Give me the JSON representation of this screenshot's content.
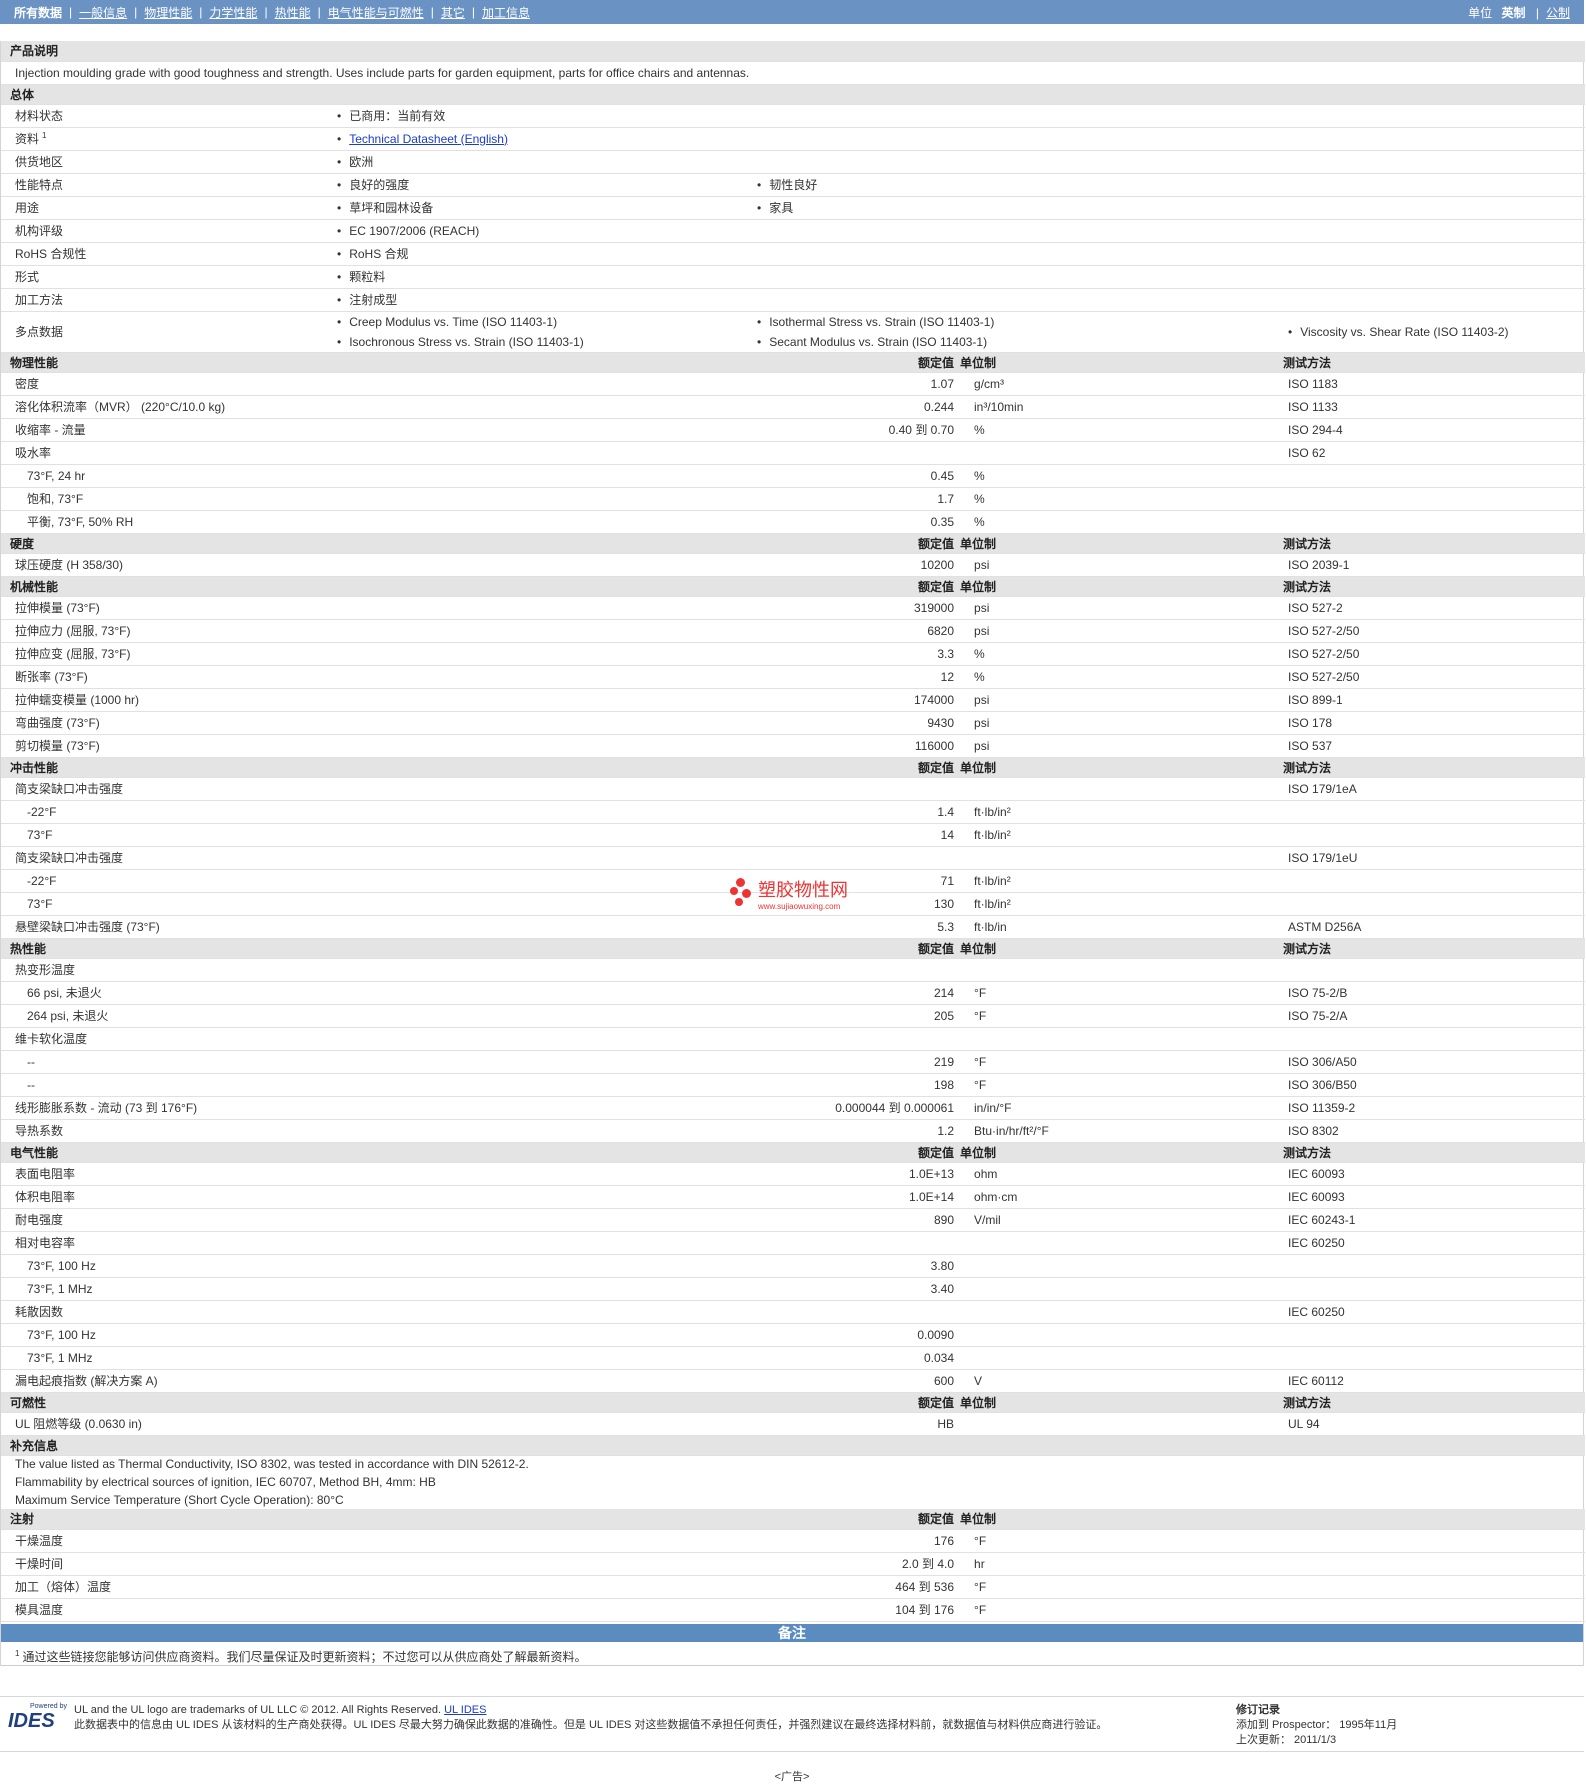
{
  "nav": {
    "tabs": [
      "所有数据",
      "一般信息",
      "物理性能",
      "力学性能",
      "热性能",
      "电气性能与可燃性",
      "其它",
      "加工信息"
    ],
    "units_label": "单位",
    "unit_active": "英制",
    "unit_other": "公制"
  },
  "headers": {
    "nominal": "额定值",
    "unit": "单位制",
    "method": "测试方法"
  },
  "description": {
    "title": "产品说明",
    "text": "Injection moulding grade with good toughness and strength. Uses include parts for garden equipment, parts for office chairs and antennas."
  },
  "general": {
    "title": "总体",
    "rows": [
      {
        "label": "材料状态",
        "col1": "已商用：当前有效"
      },
      {
        "label": "资料",
        "sup": "1",
        "link": "Technical Datasheet (English)"
      },
      {
        "label": "供货地区",
        "col1": "欧洲"
      },
      {
        "label": "性能特点",
        "col1": "良好的强度",
        "col2": "韧性良好"
      },
      {
        "label": "用途",
        "col1": "草坪和园林设备",
        "col2": "家具"
      },
      {
        "label": "机构评级",
        "col1": "EC 1907/2006 (REACH)"
      },
      {
        "label": "RoHS 合规性",
        "col1": "RoHS 合规"
      },
      {
        "label": "形式",
        "col1": "颗粒料"
      },
      {
        "label": "加工方法",
        "col1": "注射成型"
      }
    ],
    "multipoint": {
      "label": "多点数据",
      "col1": [
        "Creep Modulus vs. Time (ISO 11403-1)",
        "Isochronous Stress vs. Strain (ISO 11403-1)"
      ],
      "col2": [
        "Isothermal Stress vs. Strain (ISO 11403-1)",
        "Secant Modulus vs. Strain (ISO 11403-1)"
      ],
      "col3": [
        "Viscosity vs. Shear Rate (ISO 11403-2)"
      ]
    }
  },
  "physical": {
    "title": "物理性能",
    "rows": [
      {
        "label": "密度",
        "value": "1.07",
        "unit": "g/cm³",
        "method": "ISO 1183"
      },
      {
        "label": "溶化体积流率（MVR） (220°C/10.0 kg)",
        "value": "0.244",
        "unit": "in³/10min",
        "method": "ISO 1133"
      },
      {
        "label": "收缩率 - 流量",
        "value": "0.40 到 0.70",
        "unit": "%",
        "method": "ISO 294-4"
      },
      {
        "label": "吸水率",
        "value": "",
        "unit": "",
        "method": "ISO 62"
      },
      {
        "label": "73°F, 24 hr",
        "sub": true,
        "value": "0.45",
        "unit": "%",
        "method": ""
      },
      {
        "label": "饱和, 73°F",
        "sub": true,
        "value": "1.7",
        "unit": "%",
        "method": ""
      },
      {
        "label": "平衡, 73°F, 50% RH",
        "sub": true,
        "value": "0.35",
        "unit": "%",
        "method": ""
      }
    ]
  },
  "hardness": {
    "title": "硬度",
    "rows": [
      {
        "label": "球压硬度 (H 358/30)",
        "value": "10200",
        "unit": "psi",
        "method": "ISO 2039-1"
      }
    ]
  },
  "mechanical": {
    "title": "机械性能",
    "rows": [
      {
        "label": "拉伸模量 (73°F)",
        "value": "319000",
        "unit": "psi",
        "method": "ISO 527-2"
      },
      {
        "label": "拉伸应力 (屈服, 73°F)",
        "value": "6820",
        "unit": "psi",
        "method": "ISO 527-2/50"
      },
      {
        "label": "拉伸应变 (屈服, 73°F)",
        "value": "3.3",
        "unit": "%",
        "method": "ISO 527-2/50"
      },
      {
        "label": "断张率 (73°F)",
        "value": "12",
        "unit": "%",
        "method": "ISO 527-2/50"
      },
      {
        "label": "拉伸蠕变模量 (1000 hr)",
        "value": "174000",
        "unit": "psi",
        "method": "ISO 899-1"
      },
      {
        "label": "弯曲强度 (73°F)",
        "value": "9430",
        "unit": "psi",
        "method": "ISO 178"
      },
      {
        "label": "剪切模量 (73°F)",
        "value": "116000",
        "unit": "psi",
        "method": "ISO 537"
      }
    ]
  },
  "impact": {
    "title": "冲击性能",
    "rows": [
      {
        "label": "简支梁缺口冲击强度",
        "value": "",
        "unit": "",
        "method": "ISO 179/1eA"
      },
      {
        "label": "-22°F",
        "sub": true,
        "value": "1.4",
        "unit": "ft·lb/in²",
        "method": ""
      },
      {
        "label": "73°F",
        "sub": true,
        "value": "14",
        "unit": "ft·lb/in²",
        "method": ""
      },
      {
        "label": "简支梁缺口冲击强度",
        "value": "",
        "unit": "",
        "method": "ISO 179/1eU"
      },
      {
        "label": "-22°F",
        "sub": true,
        "value": "71",
        "unit": "ft·lb/in²",
        "method": ""
      },
      {
        "label": "73°F",
        "sub": true,
        "value": "130",
        "unit": "ft·lb/in²",
        "method": ""
      },
      {
        "label": "悬壁梁缺口冲击强度 (73°F)",
        "value": "5.3",
        "unit": "ft·lb/in",
        "method": "ASTM D256A"
      }
    ]
  },
  "thermal": {
    "title": "热性能",
    "rows": [
      {
        "label": "热变形温度",
        "value": "",
        "unit": "",
        "method": ""
      },
      {
        "label": "66 psi, 未退火",
        "sub": true,
        "value": "214",
        "unit": "°F",
        "method": "ISO 75-2/B"
      },
      {
        "label": "264 psi, 未退火",
        "sub": true,
        "value": "205",
        "unit": "°F",
        "method": "ISO 75-2/A"
      },
      {
        "label": "维卡软化温度",
        "value": "",
        "unit": "",
        "method": ""
      },
      {
        "label": "--",
        "sub": true,
        "value": "219",
        "unit": "°F",
        "method": "ISO 306/A50"
      },
      {
        "label": "--",
        "sub": true,
        "value": "198",
        "unit": "°F",
        "method": "ISO 306/B50"
      },
      {
        "label": "线形膨胀系数 - 流动 (73 到 176°F)",
        "value": "0.000044 到 0.000061",
        "unit": "in/in/°F",
        "method": "ISO 11359-2"
      },
      {
        "label": "导热系数",
        "value": "1.2",
        "unit": "Btu·in/hr/ft²/°F",
        "method": "ISO 8302"
      }
    ]
  },
  "electrical": {
    "title": "电气性能",
    "rows": [
      {
        "label": "表面电阻率",
        "value": "1.0E+13",
        "unit": "ohm",
        "method": "IEC 60093"
      },
      {
        "label": "体积电阻率",
        "value": "1.0E+14",
        "unit": "ohm·cm",
        "method": "IEC 60093"
      },
      {
        "label": "耐电强度",
        "value": "890",
        "unit": "V/mil",
        "method": "IEC 60243-1"
      },
      {
        "label": "相对电容率",
        "value": "",
        "unit": "",
        "method": "IEC 60250"
      },
      {
        "label": "73°F, 100 Hz",
        "sub": true,
        "value": "3.80",
        "unit": "",
        "method": ""
      },
      {
        "label": "73°F, 1 MHz",
        "sub": true,
        "value": "3.40",
        "unit": "",
        "method": ""
      },
      {
        "label": "耗散因数",
        "value": "",
        "unit": "",
        "method": "IEC 60250"
      },
      {
        "label": "73°F, 100 Hz",
        "sub": true,
        "value": "0.0090",
        "unit": "",
        "method": ""
      },
      {
        "label": "73°F, 1 MHz",
        "sub": true,
        "value": "0.034",
        "unit": "",
        "method": ""
      },
      {
        "label": "漏电起痕指数 (解决方案 A)",
        "value": "600",
        "unit": "V",
        "method": "IEC 60112"
      }
    ]
  },
  "flammability": {
    "title": "可燃性",
    "rows": [
      {
        "label": "UL 阻燃等级 (0.0630 in)",
        "value": "HB",
        "unit": "",
        "method": "UL 94"
      }
    ]
  },
  "supplemental": {
    "title": "补充信息",
    "lines": [
      "The value listed as Thermal Conductivity, ISO 8302, was tested in accordance with DIN 52612-2.",
      "Flammability by electrical sources of ignition, IEC 60707, Method BH, 4mm: HB",
      "Maximum Service Temperature (Short Cycle Operation): 80°C"
    ]
  },
  "injection": {
    "title": "注射",
    "rows": [
      {
        "label": "干燥温度",
        "value": "176",
        "unit": "°F"
      },
      {
        "label": "干燥时间",
        "value": "2.0 到 4.0",
        "unit": "hr"
      },
      {
        "label": "加工（熔体）温度",
        "value": "464 到 536",
        "unit": "°F"
      },
      {
        "label": "模具温度",
        "value": "104 到 176",
        "unit": "°F"
      }
    ]
  },
  "notes": {
    "title": "备注",
    "sup": "1",
    "text": "通过这些链接您能够访问供应商资料。我们尽量保证及时更新资料；不过您可以从供应商处了解最新资料。"
  },
  "footer": {
    "powered_by": "Powered by",
    "logo": "IDES",
    "line1": "UL and the UL logo are trademarks of UL LLC © 2012. All Rights Reserved.",
    "line1_link": "UL IDES",
    "line2": "此数据表中的信息由 UL IDES 从该材料的生产商处获得。UL IDES 尽最大努力确保此数据的准确性。但是 UL IDES 对这些数据值不承担任何责任，并强烈建议在最终选择材料前，就数据值与材料供应商进行验证。",
    "record_title": "修订记录",
    "added": "添加到 Prospector：  1995年11月",
    "updated": "上次更新：  2011/1/3",
    "ad": "<广告>"
  },
  "watermark": {
    "cn": "塑胶物性网",
    "url": "www.sujiaowuxing.com"
  }
}
